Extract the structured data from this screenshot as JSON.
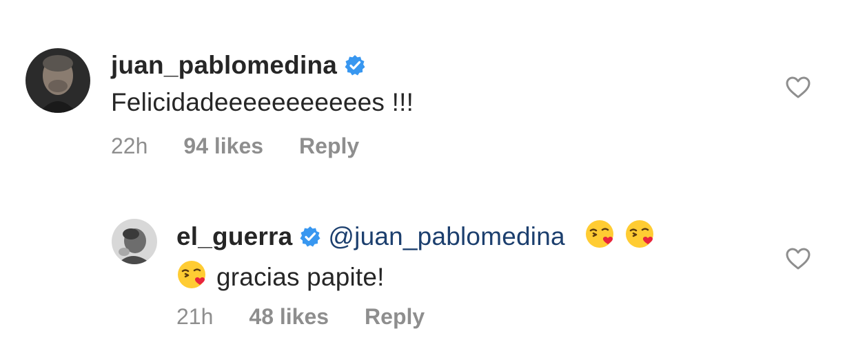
{
  "comments": [
    {
      "username": "juan_pablomedina",
      "verified": true,
      "text": "Felicidadeeeeeeeeeees !!!",
      "time": "22h",
      "likes": "94 likes",
      "reply": "Reply"
    },
    {
      "username": "el_guerra",
      "verified": true,
      "mention": "@juan_pablomedina",
      "emoji": "kissing-face-with-heart-icon",
      "text": "gracias papite!",
      "time": "21h",
      "likes": "48 likes",
      "reply": "Reply"
    }
  ],
  "colors": {
    "verified": "#3897f0",
    "meta": "#8e8e8e",
    "mention": "#1c3f6e",
    "text": "#262626"
  }
}
